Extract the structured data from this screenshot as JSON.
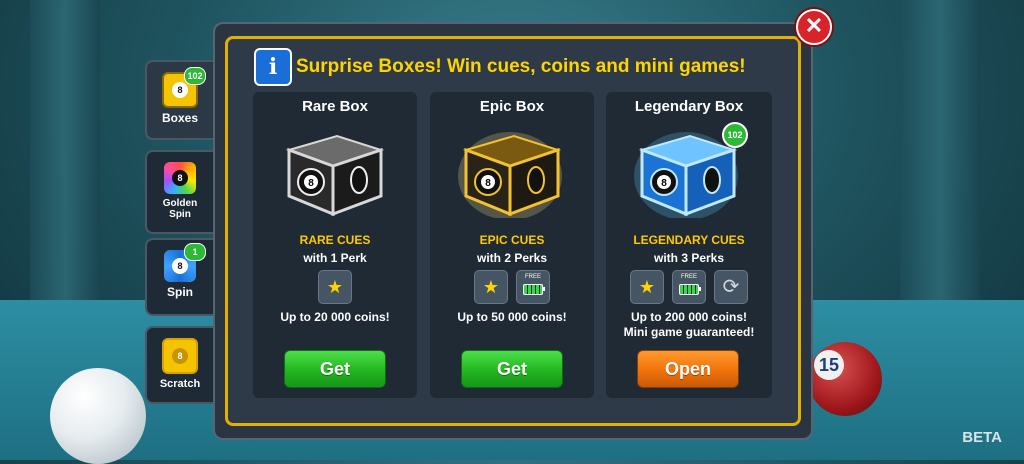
{
  "side_tabs": [
    {
      "label": "Boxes",
      "badge": "102"
    },
    {
      "label": "Golden Spin",
      "badge": ""
    },
    {
      "label": "Spin",
      "badge": "1"
    },
    {
      "label": "Scratch",
      "badge": ""
    }
  ],
  "dialog": {
    "title": "Surprise Boxes! Win cues, coins and mini games!",
    "info_icon_text": "i",
    "close_icon_text": "✕"
  },
  "boxes": [
    {
      "title": "Rare Box",
      "cues": "RARE CUES",
      "perks": "with 1 Perk",
      "coins": "Up to 20 000  coins!",
      "extra": "",
      "button": "Get",
      "badge": ""
    },
    {
      "title": "Epic Box",
      "cues": "EPIC CUES",
      "perks": "with 2 Perks",
      "coins": "Up to 50 000 coins!",
      "extra": "",
      "button": "Get",
      "badge": ""
    },
    {
      "title": "Legendary Box",
      "cues": "LEGENDARY CUES",
      "perks": "with 3 Perks",
      "coins": "Up to 200 000 coins!",
      "extra": "Mini game guaranteed!",
      "button": "Open",
      "badge": "102"
    }
  ],
  "perk_free_label": "FREE",
  "scene": {
    "ball_number": "15",
    "beta_label": "BETA"
  },
  "colors": {
    "accent_gold": "#e1b000",
    "title_yellow": "#ffd400",
    "button_green": "#22b51f",
    "button_orange": "#f0720a",
    "close_red": "#d8232b"
  }
}
